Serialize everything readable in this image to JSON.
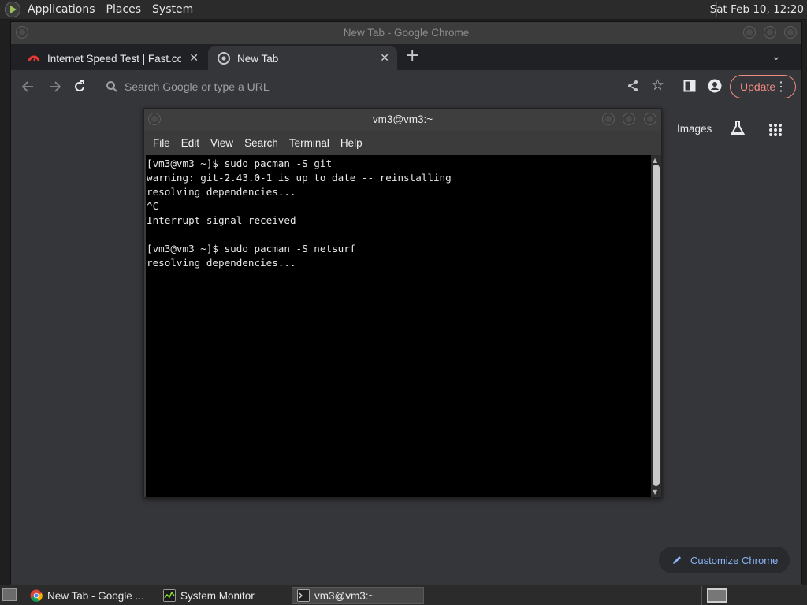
{
  "top_panel": {
    "menus": [
      "Applications",
      "Places",
      "System"
    ],
    "clock": "Sat Feb 10, 12:20"
  },
  "chrome": {
    "window_title": "New Tab - Google Chrome",
    "tabs": [
      {
        "label": "Internet Speed Test | Fast.com",
        "active": false
      },
      {
        "label": "New Tab",
        "active": true
      }
    ],
    "omnibox_placeholder": "Search Google or type a URL",
    "update_label": "Update",
    "ntp": {
      "images_link": "Images",
      "customize_label": "Customize Chrome"
    },
    "colors": {
      "update_accent": "#f28b82",
      "link_blue": "#8ab4f8"
    }
  },
  "terminal": {
    "title": "vm3@vm3:~",
    "menus": [
      "File",
      "Edit",
      "View",
      "Search",
      "Terminal",
      "Help"
    ],
    "lines": [
      "[vm3@vm3 ~]$ sudo pacman -S git",
      "warning: git-2.43.0-1 is up to date -- reinstalling",
      "resolving dependencies...",
      "^C",
      "Interrupt signal received",
      "",
      "[vm3@vm3 ~]$ sudo pacman -S netsurf",
      "resolving dependencies..."
    ]
  },
  "taskbar": {
    "items": [
      {
        "label": "New Tab - Google ...",
        "icon": "chrome-icon",
        "active": false
      },
      {
        "label": "System Monitor",
        "icon": "system-monitor-icon",
        "active": false
      },
      {
        "label": "vm3@vm3:~",
        "icon": "terminal-icon",
        "active": true
      }
    ]
  }
}
